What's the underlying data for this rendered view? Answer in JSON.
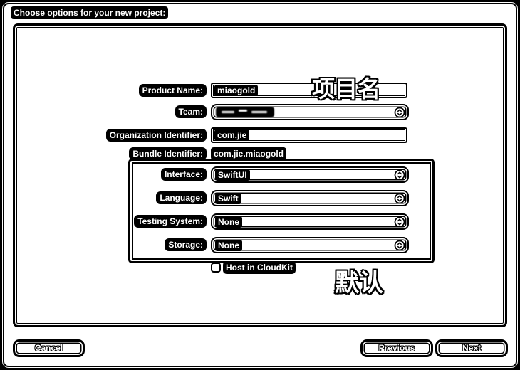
{
  "window": {
    "title": "Choose options for your new project:"
  },
  "form": {
    "product_name": {
      "label": "Product Name:",
      "value": "miaogold"
    },
    "team": {
      "label": "Team:"
    },
    "organization_identifier": {
      "label": "Organization Identifier:",
      "value": "com.jie"
    },
    "bundle_identifier": {
      "label": "Bundle Identifier:",
      "value": "com.jie.miaogold"
    },
    "interface": {
      "label": "Interface:",
      "value": "SwiftUI"
    },
    "language": {
      "label": "Language:",
      "value": "Swift"
    },
    "testing_system": {
      "label": "Testing System:",
      "value": "None"
    },
    "storage": {
      "label": "Storage:",
      "value": "None"
    },
    "host_in_cloudkit": {
      "label": "Host in CloudKit",
      "checked": false
    }
  },
  "annotations": {
    "project_name": "项目名",
    "defaults": "默认"
  },
  "buttons": {
    "cancel": "Cancel",
    "previous": "Previous",
    "next": "Next"
  },
  "icons": {
    "popup": "up-down-chevron-icon",
    "checkbox": "checkbox-icon"
  },
  "colors": {
    "foreground": "#000000",
    "background": "#ffffff"
  }
}
